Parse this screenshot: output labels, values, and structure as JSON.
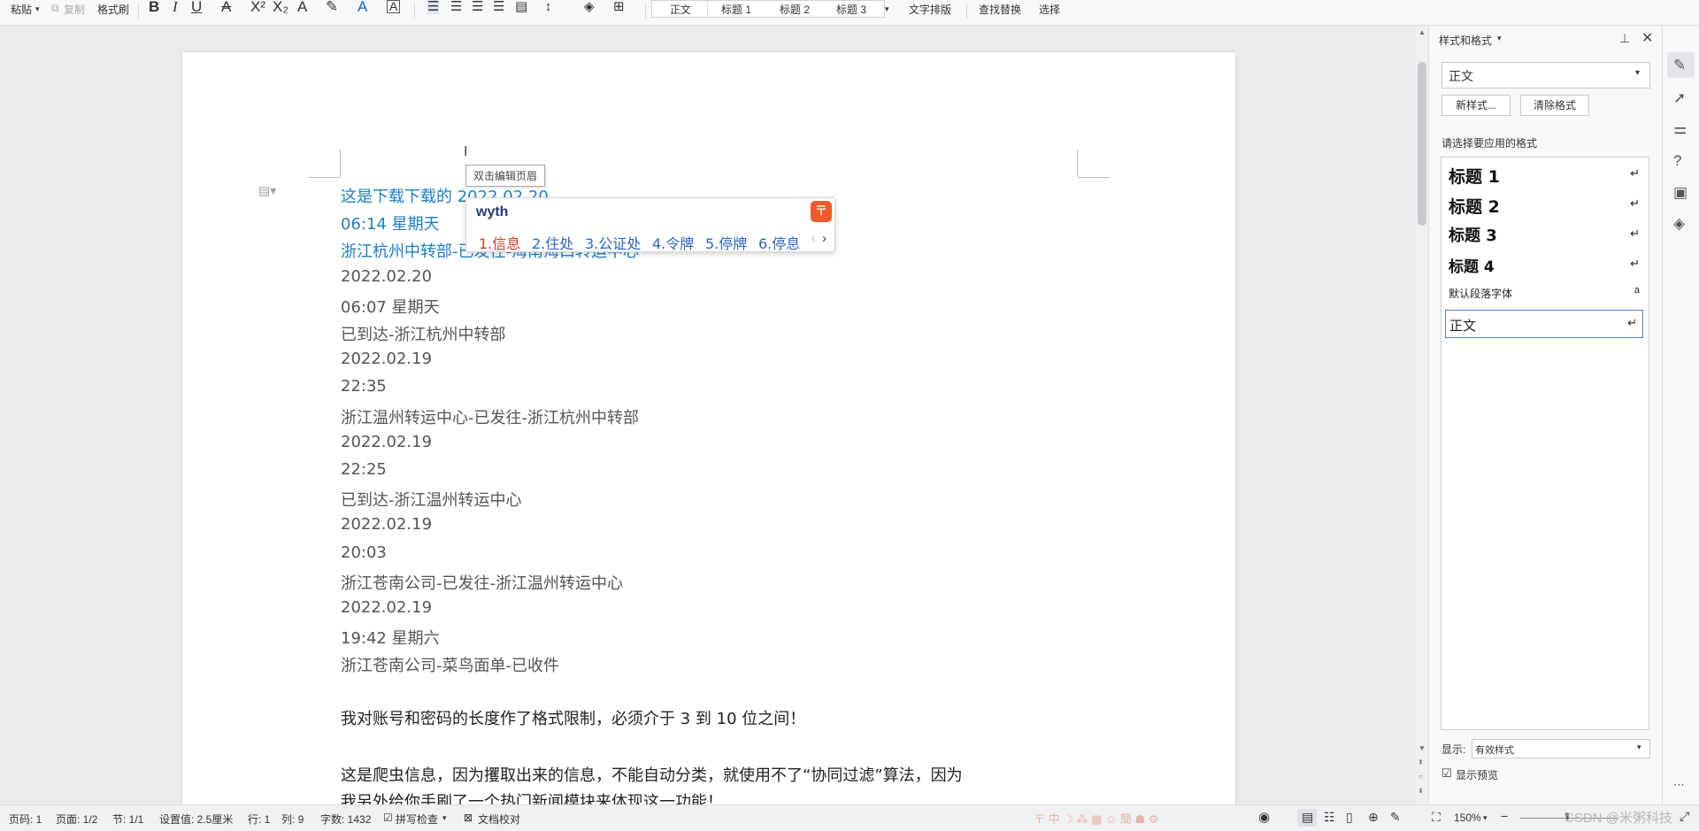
{
  "toolbar": {
    "paste": "粘贴",
    "copy": "复制",
    "format_painter": "格式刷",
    "styles": [
      "正文",
      "标题 1",
      "标题 2",
      "标题 3"
    ],
    "text_layout": "文字排版",
    "find_replace": "查找替换",
    "select": "选择"
  },
  "header_tooltip": "双击编辑页眉",
  "ime": {
    "input": "wyth",
    "candidates": [
      "1.信息",
      "2.住处",
      "3.公证处",
      "4.令牌",
      "5.停牌",
      "6.停息"
    ]
  },
  "document": {
    "lines": [
      {
        "text": "这是下载下载的  2022.02.20",
        "style": "blue"
      },
      {
        "text": "06:14  星期天",
        "style": "blue"
      },
      {
        "text": "浙江杭州中转部-已发往-海南海口转运中心",
        "style": "blue"
      },
      {
        "text": "2022.02.20",
        "style": "normal"
      },
      {
        "text": "06:07  星期天",
        "style": "normal"
      },
      {
        "text": "已到达-浙江杭州中转部",
        "style": "normal"
      },
      {
        "text": "2022.02.19",
        "style": "normal"
      },
      {
        "text": "22:35",
        "style": "normal"
      },
      {
        "text": "浙江温州转运中心-已发往-浙江杭州中转部",
        "style": "normal"
      },
      {
        "text": "2022.02.19",
        "style": "normal"
      },
      {
        "text": "22:25",
        "style": "normal"
      },
      {
        "text": "已到达-浙江温州转运中心",
        "style": "normal"
      },
      {
        "text": "2022.02.19",
        "style": "normal"
      },
      {
        "text": "20:03",
        "style": "normal"
      },
      {
        "text": "浙江苍南公司-已发往-浙江温州转运中心",
        "style": "normal"
      },
      {
        "text": "2022.02.19",
        "style": "normal"
      },
      {
        "text": "19:42  星期六",
        "style": "normal"
      },
      {
        "text": "浙江苍南公司-菜鸟面单-已收件",
        "style": "normal"
      }
    ],
    "para1": "我对账号和密码的长度作了格式限制，必须介于 3 到 10 位之间！",
    "para2": "这是爬虫信息，因为攫取出来的信息，不能自动分类，就使用不了“协同过滤”算法，因为",
    "para3": "我另外给你手刷了一个热门新闻模块来体现这一功能！"
  },
  "panel": {
    "title": "样式和格式",
    "current_style": "正文",
    "new_style": "新样式...",
    "clear_format": "清除格式",
    "choose_label": "请选择要应用的格式",
    "styles": [
      "标题  1",
      "标题  2",
      "标题  3",
      "标题  4"
    ],
    "default_font": "默认段落字体",
    "body_style": "正文",
    "show_label": "显示:",
    "show_value": "有效样式",
    "show_preview": "显示预览"
  },
  "status": {
    "page_num": "页码: 1",
    "pages": "页面: 1/2",
    "section": "节: 1/1",
    "setting": "设置值: 2.5厘米",
    "row": "行: 1",
    "col": "列: 9",
    "word_count": "字数: 1432",
    "spell_check": "拼写检查",
    "doc_proof": "文档校对",
    "zoom": "150%",
    "watermark": "CSDN @米粥科技"
  }
}
